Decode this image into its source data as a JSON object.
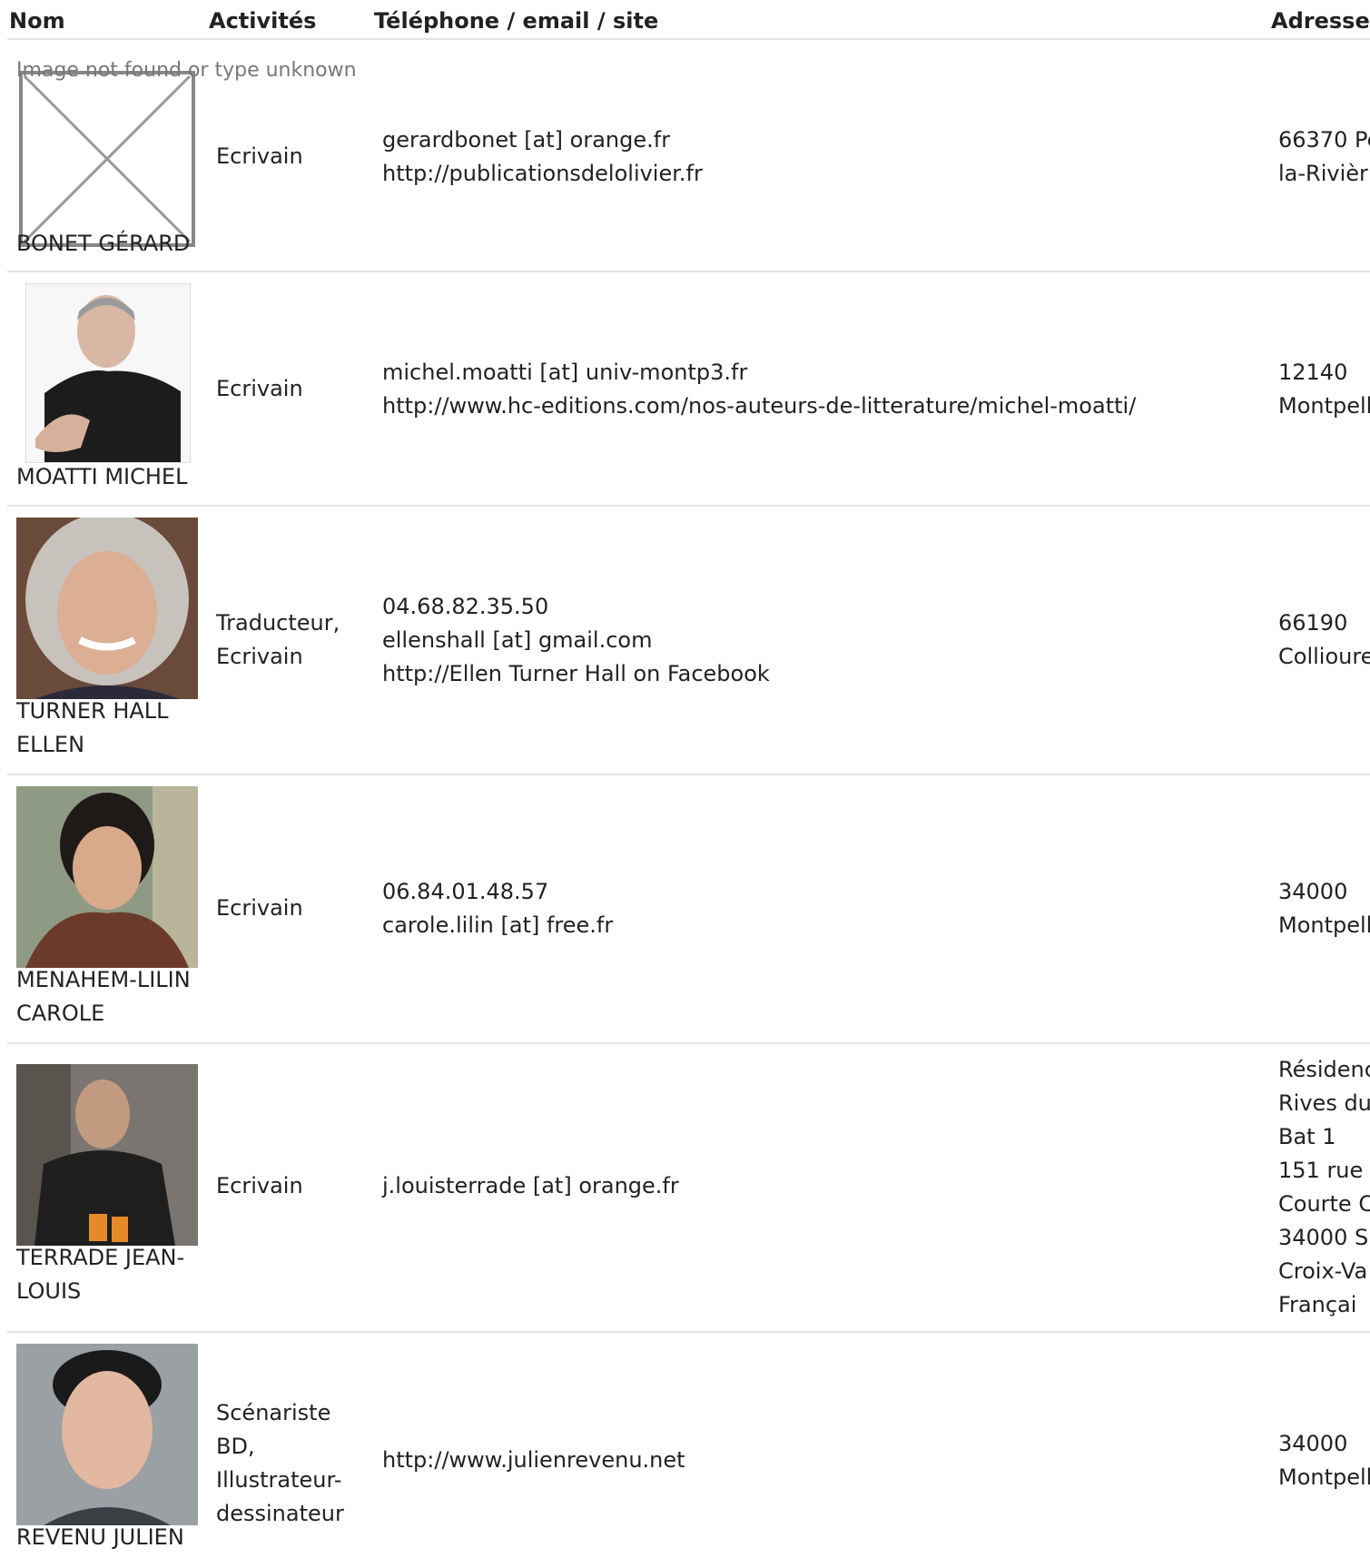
{
  "table": {
    "headers": {
      "name": "Nom",
      "activities": "Activités",
      "contact": "Téléphone / email / site",
      "address": "Adresse"
    }
  },
  "rows": [
    {
      "name": [
        "BONET GÉRARD"
      ],
      "activities": [
        "Ecrivain"
      ],
      "contact": [
        "gerardbonet [at] orange.fr",
        "http://publicationsdelolivier.fr"
      ],
      "address": [
        "66370 Pe",
        "la-Rivièr"
      ],
      "photo_alt": "Image not found or type unknown"
    },
    {
      "name": [
        "MOATTI MICHEL"
      ],
      "activities": [
        "Ecrivain"
      ],
      "contact": [
        "michel.moatti [at] univ-montp3.fr",
        "http://www.hc-editions.com/nos-auteurs-de-litterature/michel-moatti/"
      ],
      "address": [
        "12140",
        "Montpell"
      ]
    },
    {
      "name": [
        "TURNER HALL",
        "ELLEN"
      ],
      "activities": [
        "Traducteur,",
        "Ecrivain"
      ],
      "contact": [
        "04.68.82.35.50",
        "ellenshall [at] gmail.com",
        "http://Ellen Turner Hall on Facebook"
      ],
      "address": [
        "66190",
        "Collioure"
      ]
    },
    {
      "name": [
        "MENAHEM-LILIN",
        "CAROLE"
      ],
      "activities": [
        "Ecrivain"
      ],
      "contact": [
        "06.84.01.48.57",
        "carole.lilin [at] free.fr"
      ],
      "address": [
        "34000",
        "Montpell"
      ]
    },
    {
      "name": [
        "TERRADE JEAN-",
        "LOUIS"
      ],
      "activities": [
        "Ecrivain"
      ],
      "contact": [
        "j.louisterrade [at] orange.fr"
      ],
      "address": [
        "Résidenc",
        "Rives du",
        "Bat 1",
        "151 rue",
        "Courte C",
        "34000 S",
        "Croix-Va",
        "Françai"
      ]
    },
    {
      "name": [
        "REVENU JULIEN"
      ],
      "activities": [
        "Scénariste",
        "BD,",
        "Illustrateur-",
        "dessinateur"
      ],
      "contact": [
        "http://www.julienrevenu.net"
      ],
      "address": [
        "34000",
        "Montpell"
      ]
    }
  ],
  "colors": {
    "divider": "#e4e4e4",
    "text": "#222222",
    "alt_text": "#777777"
  }
}
